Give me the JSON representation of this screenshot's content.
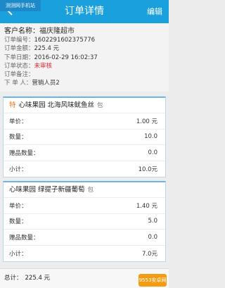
{
  "watermark": "测测网手机站",
  "header": {
    "title": "订单详情",
    "edit_label": "编辑",
    "back_icon": "back-arrow-icon"
  },
  "order": {
    "customer_label": "客户名称：",
    "customer_value": "福庆隆超市",
    "number_label": "订单编号：",
    "number_value": "1602291602375776",
    "amount_label": "订单金额：",
    "amount_value": "225.4 元",
    "date_label": "下单日期：",
    "date_value": "2016-02-29 16:02:37",
    "status_label": "订单状态：",
    "status_value": "未审核",
    "status_color": "#e0262a",
    "note_label": "订单备注：",
    "note_value": "",
    "creator_label": "下 单 人：",
    "creator_value": "营销人员2"
  },
  "items": [
    {
      "tag": "特",
      "name": "心味果园 北海风味鱿鱼丝",
      "unit": "包",
      "rows": [
        {
          "label": "单价：",
          "value": "1.00 元"
        },
        {
          "label": "数量：",
          "value": "10.0"
        },
        {
          "label": "赠品数量：",
          "value": "0.0"
        },
        {
          "label": "小计：",
          "value": "10.0元"
        }
      ]
    },
    {
      "tag": "",
      "name": "心味果园 绿提子新疆葡萄",
      "unit": "包",
      "rows": [
        {
          "label": "单价：",
          "value": "1.40 元"
        },
        {
          "label": "数量：",
          "value": "5.0"
        },
        {
          "label": "赠品数量：",
          "value": "0.0"
        },
        {
          "label": "小计：",
          "value": "7.0元"
        }
      ]
    }
  ],
  "footer": {
    "total_label": "总计：",
    "total_value": "225.4  元"
  },
  "logo_text": "9553安卓网"
}
